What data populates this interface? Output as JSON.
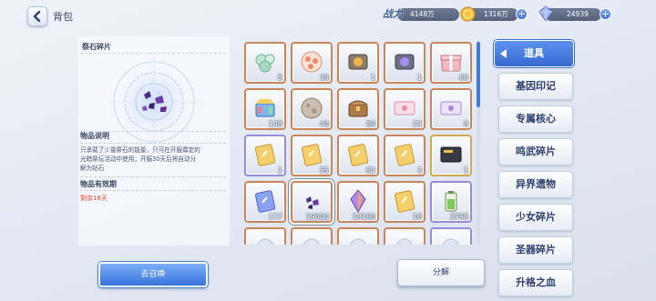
{
  "header": {
    "title": "背包",
    "power_label": "战力",
    "power_value": "4148万",
    "gold_value": "1316万",
    "gems_value": "24939"
  },
  "detail": {
    "item_name": "祭石碎片",
    "desc_heading": "物品说明",
    "desc_lines": [
      "只承载了少量祭石的能量，只可在开服靡定的",
      "光暗祭坛活动中使用；开服30天后将自动分",
      "解为钻石"
    ],
    "expiry_heading": "物品有效期",
    "remaining": "剩余18天"
  },
  "grid": {
    "items": [
      {
        "icon": "pearls-icon",
        "count": "5",
        "border": "orange"
      },
      {
        "icon": "crystal-cluster-icon",
        "count": "39",
        "border": "orange"
      },
      {
        "icon": "gem-box-icon",
        "count": "1",
        "border": "orange"
      },
      {
        "icon": "purple-gem-box-icon",
        "count": "1",
        "border": "orange"
      },
      {
        "icon": "gift-box-icon",
        "count": "68",
        "border": "orange"
      },
      {
        "icon": "rainbow-chest-icon",
        "count": "138",
        "border": "orange"
      },
      {
        "icon": "stone-orb-icon",
        "count": "40",
        "border": "orange"
      },
      {
        "icon": "treasure-chest-icon",
        "count": "50",
        "border": "orange"
      },
      {
        "icon": "pink-ticket-icon",
        "count": "23",
        "border": "orange"
      },
      {
        "icon": "purple-ticket-icon",
        "count": "8",
        "border": "orange"
      },
      {
        "icon": "gold-card-icon",
        "count": "1",
        "border": "purple"
      },
      {
        "icon": "gold-card-icon",
        "count": "55",
        "border": "orange"
      },
      {
        "icon": "gold-card-icon",
        "count": "82",
        "border": "orange"
      },
      {
        "icon": "gold-card-icon",
        "count": "3",
        "border": "orange"
      },
      {
        "icon": "black-card-icon",
        "count": "1",
        "border": "gold"
      },
      {
        "icon": "blue-card-icon",
        "count": "177",
        "border": "orange"
      },
      {
        "icon": "altar-shard-icon",
        "count": "19000",
        "border": "orange",
        "selected": true
      },
      {
        "icon": "prism-crystal-icon",
        "count": "18180",
        "border": "orange"
      },
      {
        "icon": "gold-card-icon",
        "count": "10",
        "border": "orange"
      },
      {
        "icon": "battery-icon",
        "count": "3798",
        "border": "purple"
      },
      {
        "icon": "item-icon",
        "count": "",
        "border": "orange"
      },
      {
        "icon": "item-icon",
        "count": "",
        "border": "orange"
      },
      {
        "icon": "item-icon",
        "count": "",
        "border": "orange"
      },
      {
        "icon": "item-icon",
        "count": "",
        "border": "orange"
      },
      {
        "icon": "item-icon",
        "count": "",
        "border": "purple"
      }
    ]
  },
  "categories": [
    {
      "label": "道具",
      "active": true
    },
    {
      "label": "基因印记"
    },
    {
      "label": "专属核心"
    },
    {
      "label": "鸣武碎片"
    },
    {
      "label": "异界遗物"
    },
    {
      "label": "少女碎片"
    },
    {
      "label": "圣器碎片"
    },
    {
      "label": "升格之血"
    }
  ],
  "buttons": {
    "summon": "去召唤",
    "decompose": "分解"
  },
  "colors": {
    "accent_blue": "#3f7be0",
    "rare_orange": "#c9845a",
    "rare_purple": "#9a8bd6",
    "warning_red": "#e04b3c"
  }
}
